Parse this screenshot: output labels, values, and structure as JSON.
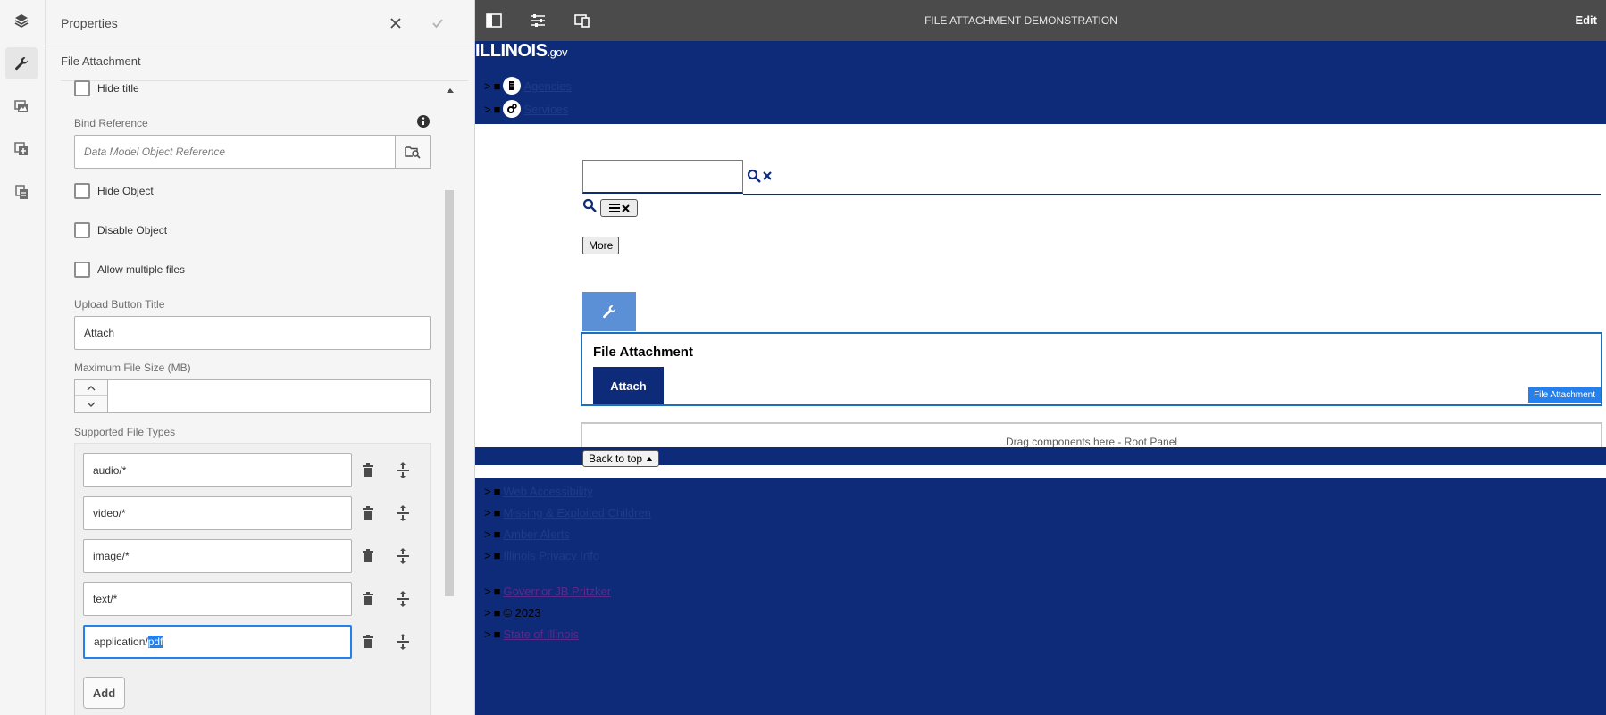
{
  "panel": {
    "title": "Properties",
    "component_name": "File Attachment",
    "hide_title_label": "Hide title",
    "bind_reference_label": "Bind Reference",
    "bind_reference_placeholder": "Data Model Object Reference",
    "hide_object_label": "Hide Object",
    "disable_object_label": "Disable Object",
    "allow_multiple_label": "Allow multiple files",
    "upload_button_title_label": "Upload Button Title",
    "upload_button_title_value": "Attach",
    "max_file_size_label": "Maximum File Size (MB)",
    "max_file_size_value": "",
    "supported_types_label": "Supported File Types",
    "file_types": [
      "audio/*",
      "video/*",
      "image/*",
      "text/*"
    ],
    "last_type_prefix": "application/",
    "last_type_selected": "pdf",
    "add_label": "Add"
  },
  "topbar": {
    "page_name": "FILE ATTACHMENT DEMONSTRATION",
    "mode": "Edit"
  },
  "site": {
    "logo_main": "ILLINOIS",
    "logo_suffix": ".gov",
    "nav_bullets": ">",
    "nav_items": [
      "Agencies",
      "Services"
    ],
    "more_label": "More",
    "form_title": "File Attachment",
    "attach_label": "Attach",
    "component_tag": "File Attachment",
    "drop_zone": "Drag components here - Root Panel",
    "back_to_top": "Back to top",
    "footer_links": [
      "Web Accessibility",
      "Missing & Exploited Children",
      "Amber Alerts",
      "Illinois Privacy Info"
    ],
    "governor": "Governor JB Pritzker",
    "copyright": "© 2023",
    "state": "State of Illinois"
  },
  "colors": {
    "illinois_blue": "#0e2b7a",
    "selection_blue": "#2680eb",
    "topbar": "#4b4b4b"
  }
}
